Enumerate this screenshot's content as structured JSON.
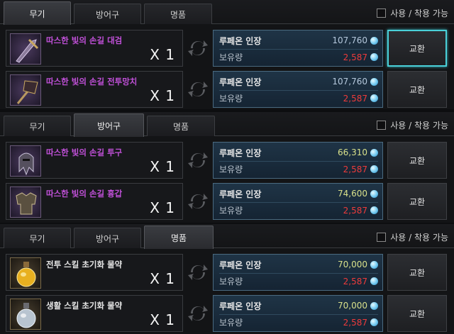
{
  "filter_label": "사용 / 착용 가능",
  "exchange_label": "교환",
  "currency_label": "루페온 인장",
  "owned_label": "보유량",
  "sections": [
    {
      "tabs": [
        "무기",
        "방어구",
        "명품"
      ],
      "active_tab": 0,
      "items": [
        {
          "name": "따스한 빛의 손길 대검",
          "qty": "X 1",
          "cost": "107,760",
          "owned": "2,587"
        },
        {
          "name": "따스한 빛의 손길 전투망치",
          "qty": "X 1",
          "cost": "107,760",
          "owned": "2,587"
        }
      ]
    },
    {
      "tabs": [
        "무기",
        "방어구",
        "명품"
      ],
      "active_tab": 1,
      "items": [
        {
          "name": "따스한 빛의 손길 투구",
          "qty": "X 1",
          "cost": "66,310",
          "owned": "2,587"
        },
        {
          "name": "따스한 빛의 손길 흉갑",
          "qty": "X 1",
          "cost": "74,600",
          "owned": "2,587"
        }
      ]
    },
    {
      "tabs": [
        "무기",
        "방어구",
        "명품"
      ],
      "active_tab": 2,
      "items": [
        {
          "name": "전투 스킬 초기화 물약",
          "qty": "X 1",
          "cost": "70,000",
          "owned": "2,587"
        },
        {
          "name": "생활 스킬 초기화 물약",
          "qty": "X 1",
          "cost": "70,000",
          "owned": "2,587"
        }
      ]
    }
  ]
}
